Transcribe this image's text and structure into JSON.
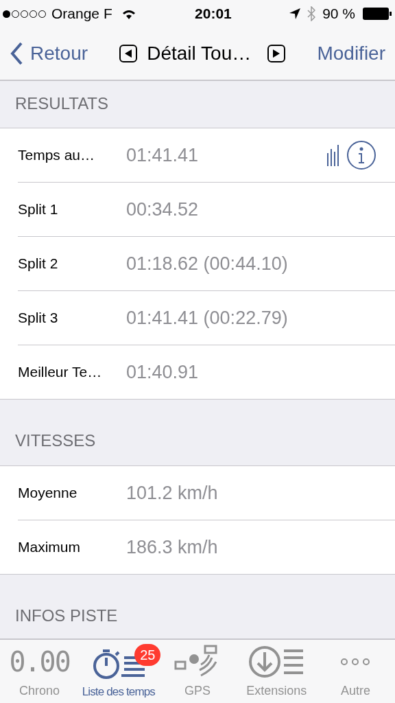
{
  "status_bar": {
    "signal_dots": [
      {
        "on": true
      },
      {
        "on": false
      },
      {
        "on": false
      },
      {
        "on": false
      },
      {
        "on": false
      }
    ],
    "carrier": "Orange F",
    "time": "20:01",
    "battery": "90 %"
  },
  "nav": {
    "back": "Retour",
    "title": "Détail Tou…",
    "action": "Modifier"
  },
  "sections": [
    {
      "title": "RESULTATS",
      "rows": [
        {
          "label": "Temps au…",
          "value": "01:41.41",
          "has_actions": true
        },
        {
          "label": "Split 1",
          "value": "00:34.52",
          "has_actions": false
        },
        {
          "label": "Split 2",
          "value": "01:18.62 (00:44.10)",
          "has_actions": false
        },
        {
          "label": "Split 3",
          "value": "01:41.41 (00:22.79)",
          "has_actions": false
        },
        {
          "label": "Meilleur Te…",
          "value": "01:40.91",
          "has_actions": false
        }
      ]
    },
    {
      "title": "VITESSES",
      "rows": [
        {
          "label": "Moyenne",
          "value": "101.2 km/h",
          "has_actions": false
        },
        {
          "label": "Maximum",
          "value": "186.3 km/h",
          "has_actions": false
        }
      ]
    },
    {
      "title": "INFOS PISTE"
    }
  ],
  "tab_bar": [
    {
      "kind": "chrono",
      "label": "Chrono",
      "glyph": "0.00",
      "selected": false
    },
    {
      "kind": "list",
      "label": "Liste des temps",
      "badge": "25",
      "selected": true
    },
    {
      "kind": "gps",
      "label": "GPS",
      "selected": false
    },
    {
      "kind": "extensions",
      "label": "Extensions",
      "selected": false
    },
    {
      "kind": "more",
      "label": "Autre",
      "selected": false
    }
  ]
}
